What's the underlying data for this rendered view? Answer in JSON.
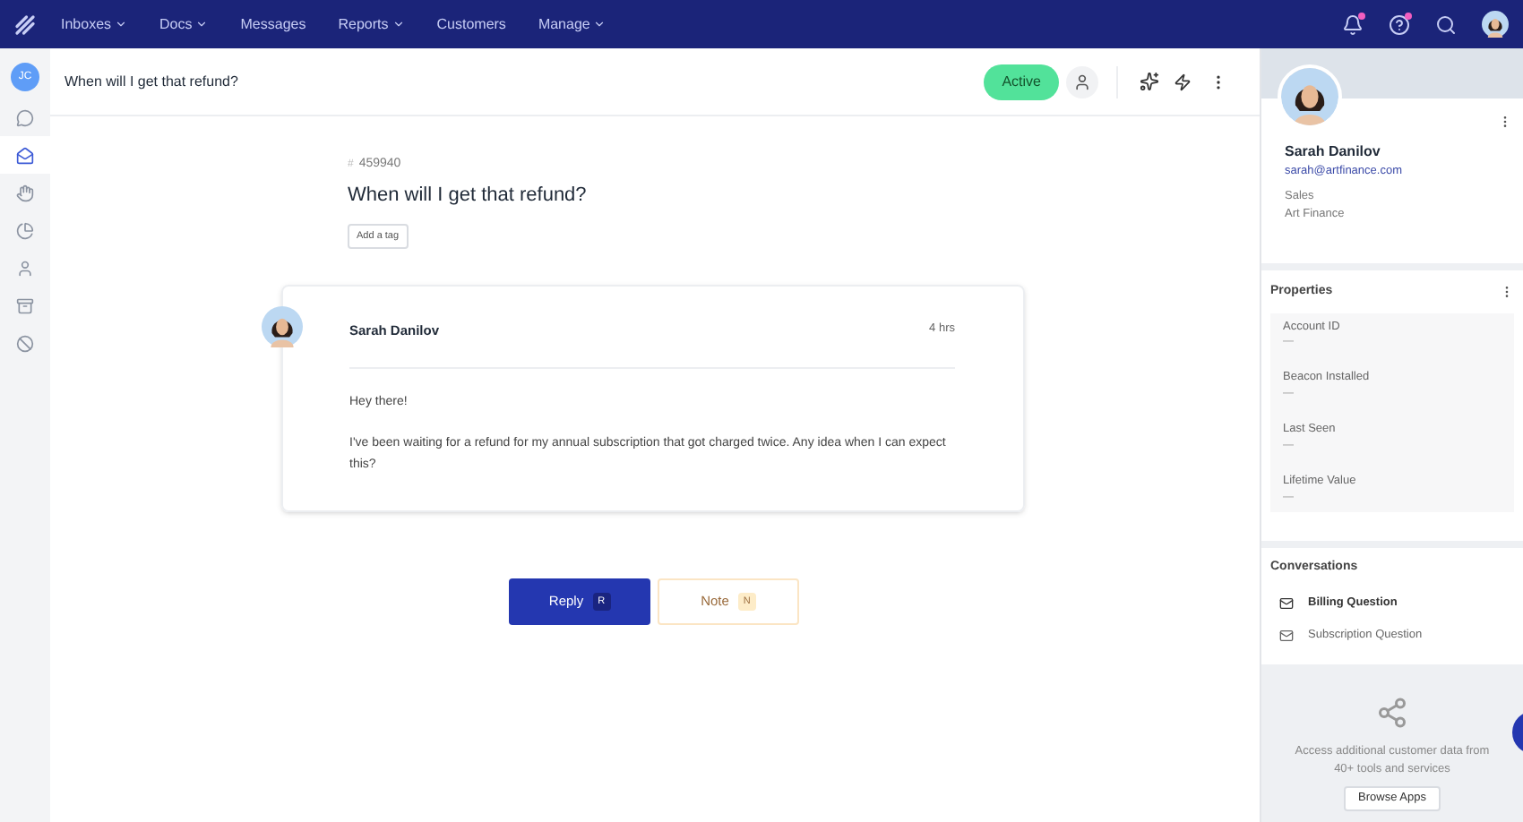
{
  "nav": {
    "items": [
      {
        "label": "Inboxes",
        "dropdown": true
      },
      {
        "label": "Docs",
        "dropdown": true
      },
      {
        "label": "Messages",
        "dropdown": false
      },
      {
        "label": "Reports",
        "dropdown": true
      },
      {
        "label": "Customers",
        "dropdown": false
      },
      {
        "label": "Manage",
        "dropdown": true
      }
    ]
  },
  "rail": {
    "avatar": "JC",
    "items": [
      {
        "kind": "chat",
        "selected": false
      },
      {
        "kind": "inbox",
        "selected": true
      },
      {
        "kind": "hand",
        "selected": false
      },
      {
        "kind": "pie",
        "selected": false
      },
      {
        "kind": "user",
        "selected": false
      },
      {
        "kind": "archive",
        "selected": false
      },
      {
        "kind": "ban",
        "selected": false
      }
    ]
  },
  "header": {
    "title": "When will I get that refund?",
    "status": "Active"
  },
  "conversation": {
    "number_mark": "#",
    "number": "459940",
    "title": "When will I get that refund?",
    "tag_button": "Add a tag"
  },
  "message": {
    "author": "Sarah Danilov",
    "time": "4 hrs",
    "greeting": "Hey there!",
    "body": "I've been waiting for a refund for my annual subscription that got charged twice. Any idea when I can expect this?"
  },
  "actions": [
    {
      "label": "Reply",
      "key": "R",
      "kind": "primary"
    },
    {
      "label": "Note",
      "key": "N",
      "kind": "note"
    }
  ],
  "customer": {
    "name": "Sarah Danilov",
    "email": "sarah@artfinance.com",
    "role": "Sales",
    "company": "Art Finance"
  },
  "properties": {
    "title": "Properties",
    "items": [
      {
        "label": "Account ID",
        "value": "—"
      },
      {
        "label": "Beacon Installed",
        "value": "—"
      },
      {
        "label": "Last Seen",
        "value": "—"
      },
      {
        "label": "Lifetime Value",
        "value": "—"
      }
    ]
  },
  "conversations": {
    "title": "Conversations",
    "items": [
      {
        "label": "Billing Question",
        "selected": true
      },
      {
        "label": "Subscription Question",
        "selected": false
      }
    ]
  },
  "apps": {
    "text": "Access additional customer data from 40+ tools and services",
    "button": "Browse Apps"
  }
}
